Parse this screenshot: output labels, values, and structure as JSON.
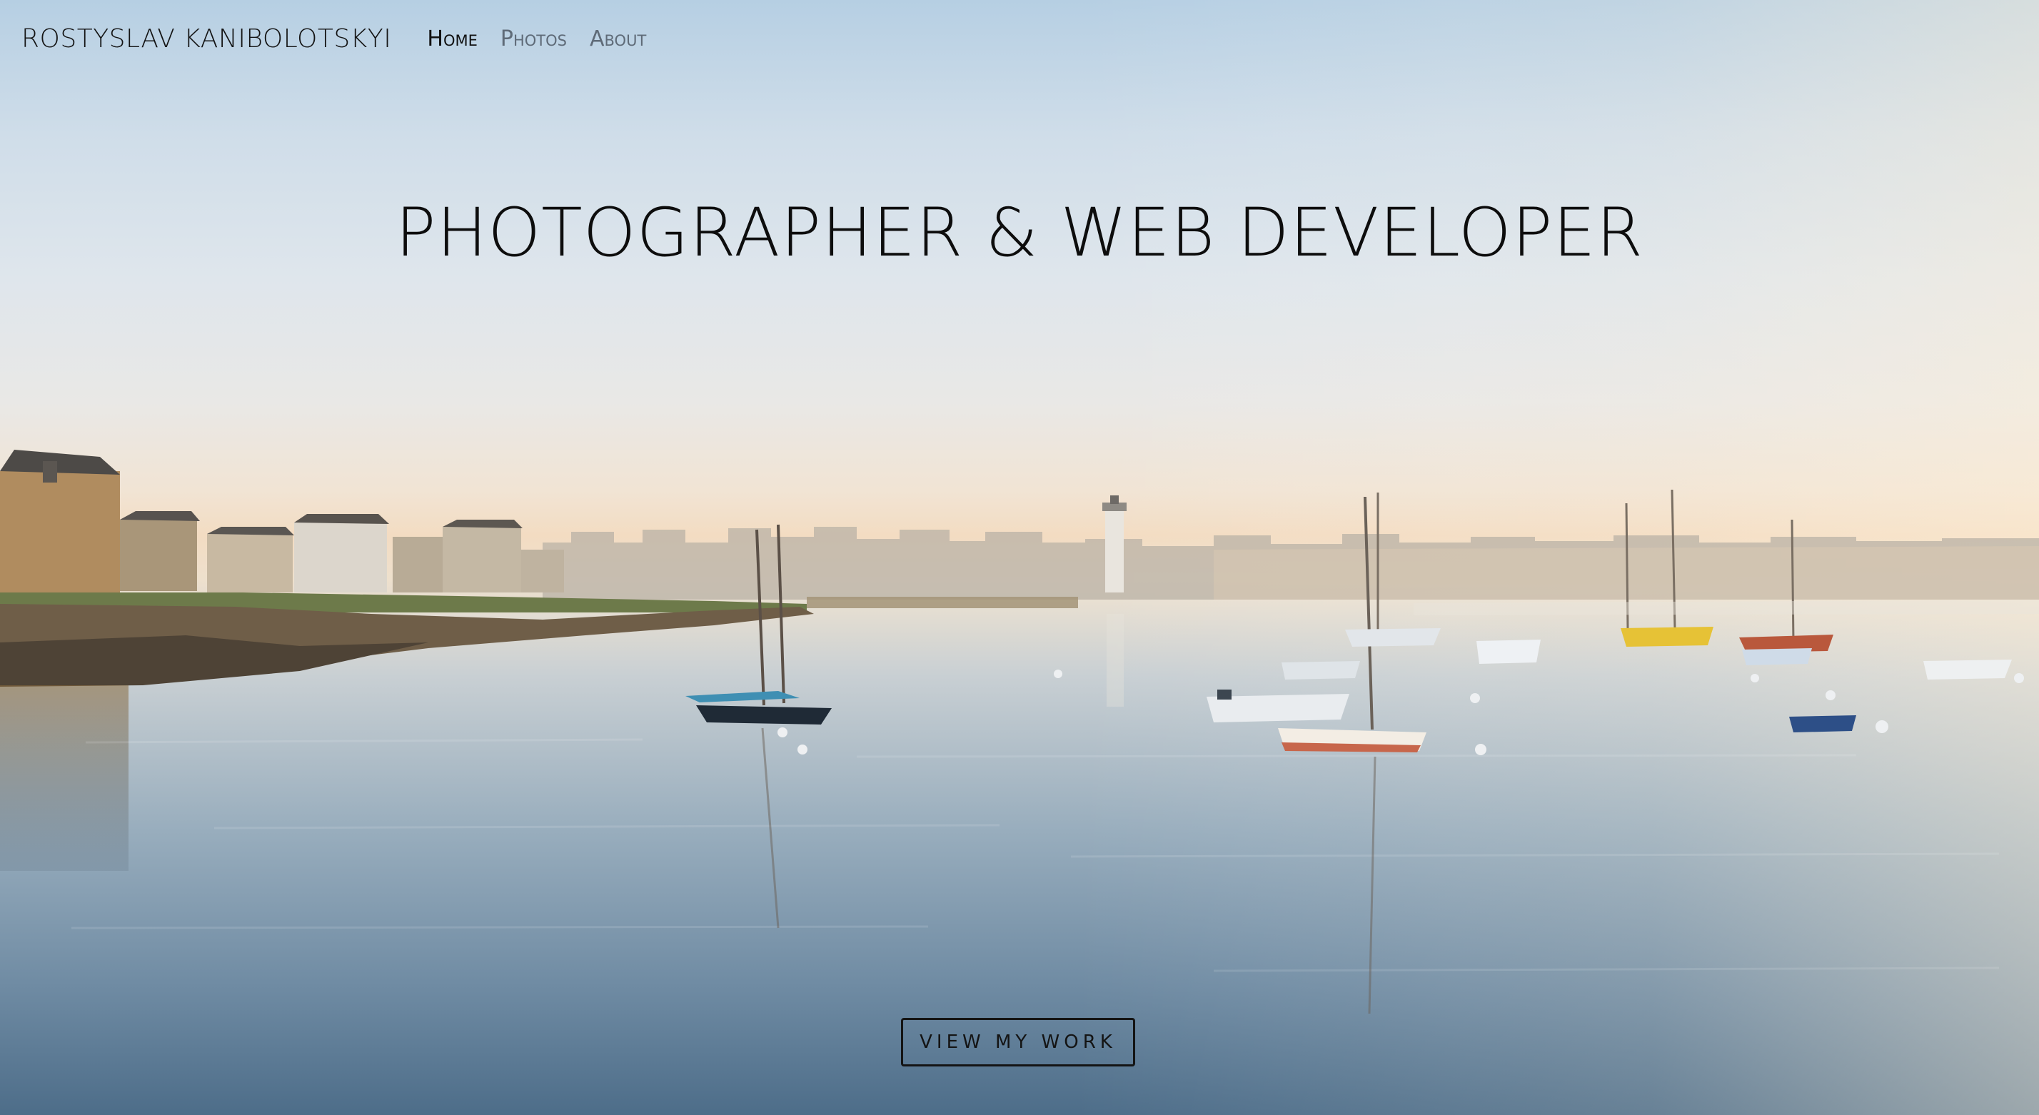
{
  "nav": {
    "brand": "ROSTYSLAV KANIBOLOTSKYI",
    "items": [
      {
        "label": "Home",
        "active": true
      },
      {
        "label": "Photos",
        "active": false
      },
      {
        "label": "About",
        "active": false
      }
    ]
  },
  "hero": {
    "title": "PHOTOGRAPHER & WEB DEVELOPER",
    "cta_label": "VIEW MY WORK"
  },
  "colors": {
    "text": "#141414",
    "nav_inactive": "#5f6b78",
    "sky_top": "#b6cfe3",
    "horizon": "#f3dcc2",
    "water_bottom": "#4c6c88"
  }
}
